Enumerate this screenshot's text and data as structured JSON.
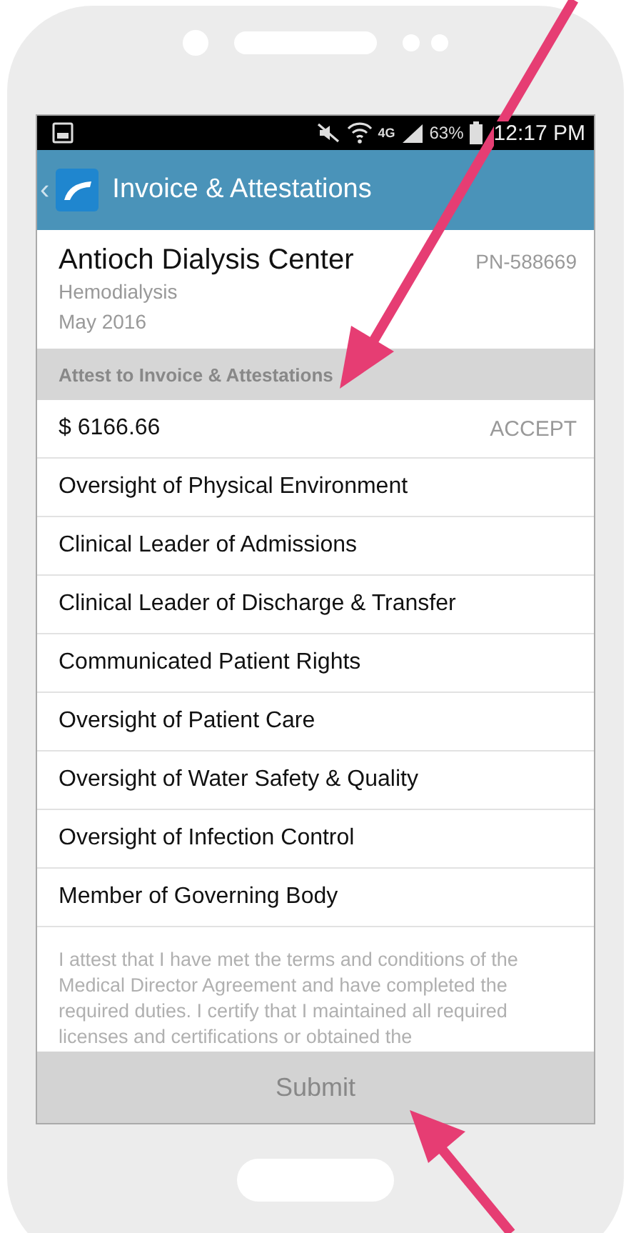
{
  "status_bar": {
    "network": "4G",
    "battery": "63%",
    "time": "12:17 PM"
  },
  "header": {
    "back": "‹",
    "title": "Invoice & Attestations"
  },
  "facility": {
    "name": "Antioch Dialysis Center",
    "provider_number": "PN-588669",
    "service": "Hemodialysis",
    "period": "May 2016"
  },
  "section_title": "Attest to Invoice & Attestations",
  "invoice": {
    "amount": "$ 6166.66",
    "action": "ACCEPT"
  },
  "attestations": [
    {
      "label": "Oversight of Physical Environment"
    },
    {
      "label": "Clinical Leader of Admissions"
    },
    {
      "label": "Clinical Leader of Discharge & Transfer"
    },
    {
      "label": "Communicated Patient Rights"
    },
    {
      "label": "Oversight of Patient Care"
    },
    {
      "label": "Oversight of Water Safety & Quality"
    },
    {
      "label": "Oversight of Infection Control"
    },
    {
      "label": "Member of Governing Body"
    }
  ],
  "statement": "I attest that I have met the terms and conditions of the Medical Director Agreement and have completed the required duties. I certify that I maintained all required licenses and certifications or obtained the",
  "submit": {
    "label": "Submit",
    "disabled": true
  }
}
